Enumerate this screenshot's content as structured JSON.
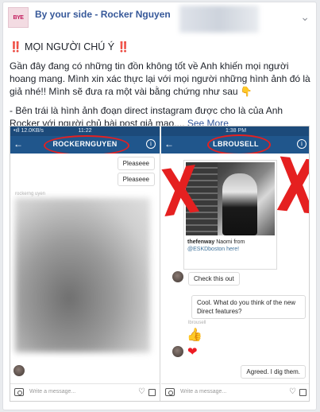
{
  "post": {
    "page_name": "By your side - Rocker Nguyen",
    "avatar_text": "BYE",
    "title_line": "‼️ MỌI NGƯỜI CHÚ Ý ‼️",
    "paragraph1": "Gần đây đang có những tin đồn không tốt về Anh khiến mọi người hoang mang. Mình xin xác thực lại với mọi người những hình ảnh đó là giả nhé!! Mình sẽ đưa ra một vài bằng chứng như sau 👇",
    "paragraph2": "- Bên trái là hình ảnh đoạn direct instagram được cho là của Anh Rocker với người chủ bài post giả mạo.... ",
    "see_more": "See More"
  },
  "left_phone": {
    "status_left": "•ıll 12.0KB/s",
    "status_time": "11:22",
    "nav_title": "ROCKERNGUYEN",
    "messages": [
      "Pleaseee",
      "Pleaseee"
    ],
    "sender_label": "rockerng uyen",
    "composer_placeholder": "Write a message..."
  },
  "right_phone": {
    "status_time": "1:38 PM",
    "nav_title": "LBROUSELL",
    "caption_user": "thefenway",
    "caption_text": "Naomi from",
    "caption_handle": "@ESKDboston here!",
    "msg_check": "Check this out",
    "msg_cool": "Cool. What do you think of the new Direct features?",
    "sender_label": "lbrousell",
    "msg_agreed": "Agreed. I dig them.",
    "composer_placeholder": "Write a message..."
  },
  "colors": {
    "fb_link": "#365899",
    "ig_nav": "#20568c",
    "annotation_red": "#e52020"
  },
  "icons": {
    "back": "←",
    "info": "i",
    "options": "⌄",
    "heart": "♡",
    "thumbs_up": "👍",
    "heart_filled": "❤",
    "x_mark": "X"
  }
}
